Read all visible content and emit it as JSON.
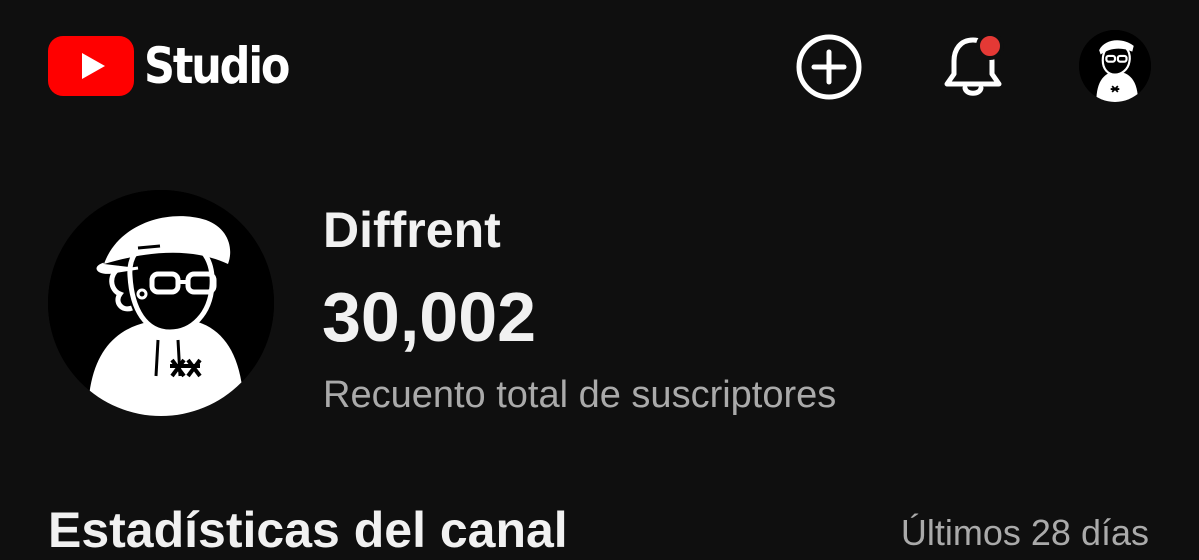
{
  "header": {
    "app_name": "Studio",
    "brand_color": "#ff0000",
    "create_icon": "plus-circle-icon",
    "notifications_icon": "bell-icon",
    "notification_dot_color": "#e53935",
    "account_icon": "avatar"
  },
  "channel": {
    "name": "Diffrent",
    "subscriber_count": "30,002",
    "subscriber_caption": "Recuento total de suscriptores"
  },
  "stats_section": {
    "title": "Estadísticas del canal",
    "range": "Últimos 28 días"
  }
}
